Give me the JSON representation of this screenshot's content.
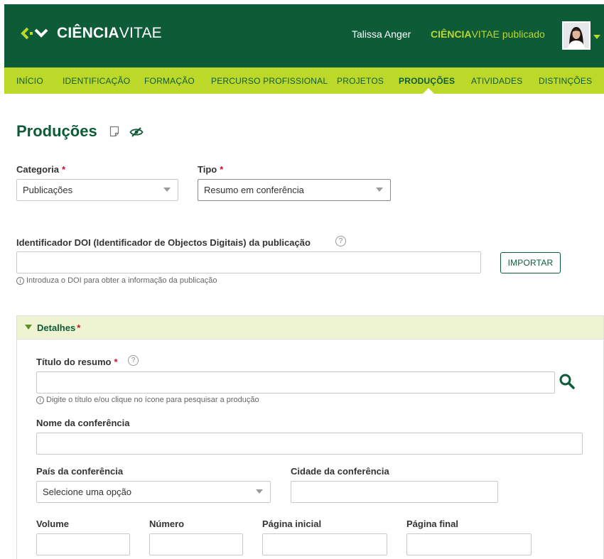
{
  "header": {
    "logo_bold": "CIÊNCIA",
    "logo_light": "VITAE",
    "user_name": "Talissa Anger",
    "published_bold": "CIÊNCIA",
    "published_rest": "VITAE publicado"
  },
  "nav": {
    "items": [
      "INÍCIO",
      "IDENTIFICAÇÃO",
      "FORMAÇÃO",
      "PERCURSO PROFISSIONAL",
      "PROJETOS",
      "PRODUÇÕES",
      "ATIVIDADES",
      "DISTINÇÕES"
    ],
    "active": "PRODUÇÕES"
  },
  "page": {
    "title": "Produções"
  },
  "form": {
    "categoria_label": "Categoria",
    "categoria_value": "Publicações",
    "tipo_label": "Tipo",
    "tipo_value": "Resumo em conferência",
    "doi_label": "Identificador DOI (Identificador de Objectos Digitais) da publicação",
    "doi_value": "",
    "doi_hint": "Introduza o DOI para obter a informação da publicação",
    "import_button": "IMPORTAR",
    "required_mark": "*",
    "help_mark": "?",
    "info_mark": "i"
  },
  "details": {
    "section_title": "Detalhes",
    "titulo_label": "Título do resumo",
    "titulo_value": "",
    "titulo_hint": "Digite o título e/ou clique no ícone para pesquisar a produção",
    "nome_label": "Nome da conferência",
    "nome_value": "",
    "pais_label": "País da conferência",
    "pais_value": "Selecione uma opção",
    "cidade_label": "Cidade da conferência",
    "cidade_value": "",
    "volume_label": "Volume",
    "numero_label": "Número",
    "pagina_inicial_label": "Página inicial",
    "pagina_final_label": "Página final"
  },
  "colors": {
    "header_green": "#0e5b37",
    "nav_lime": "#bcd92a",
    "required_red": "#c8102e",
    "panel_header_bg": "#eef4d2"
  }
}
